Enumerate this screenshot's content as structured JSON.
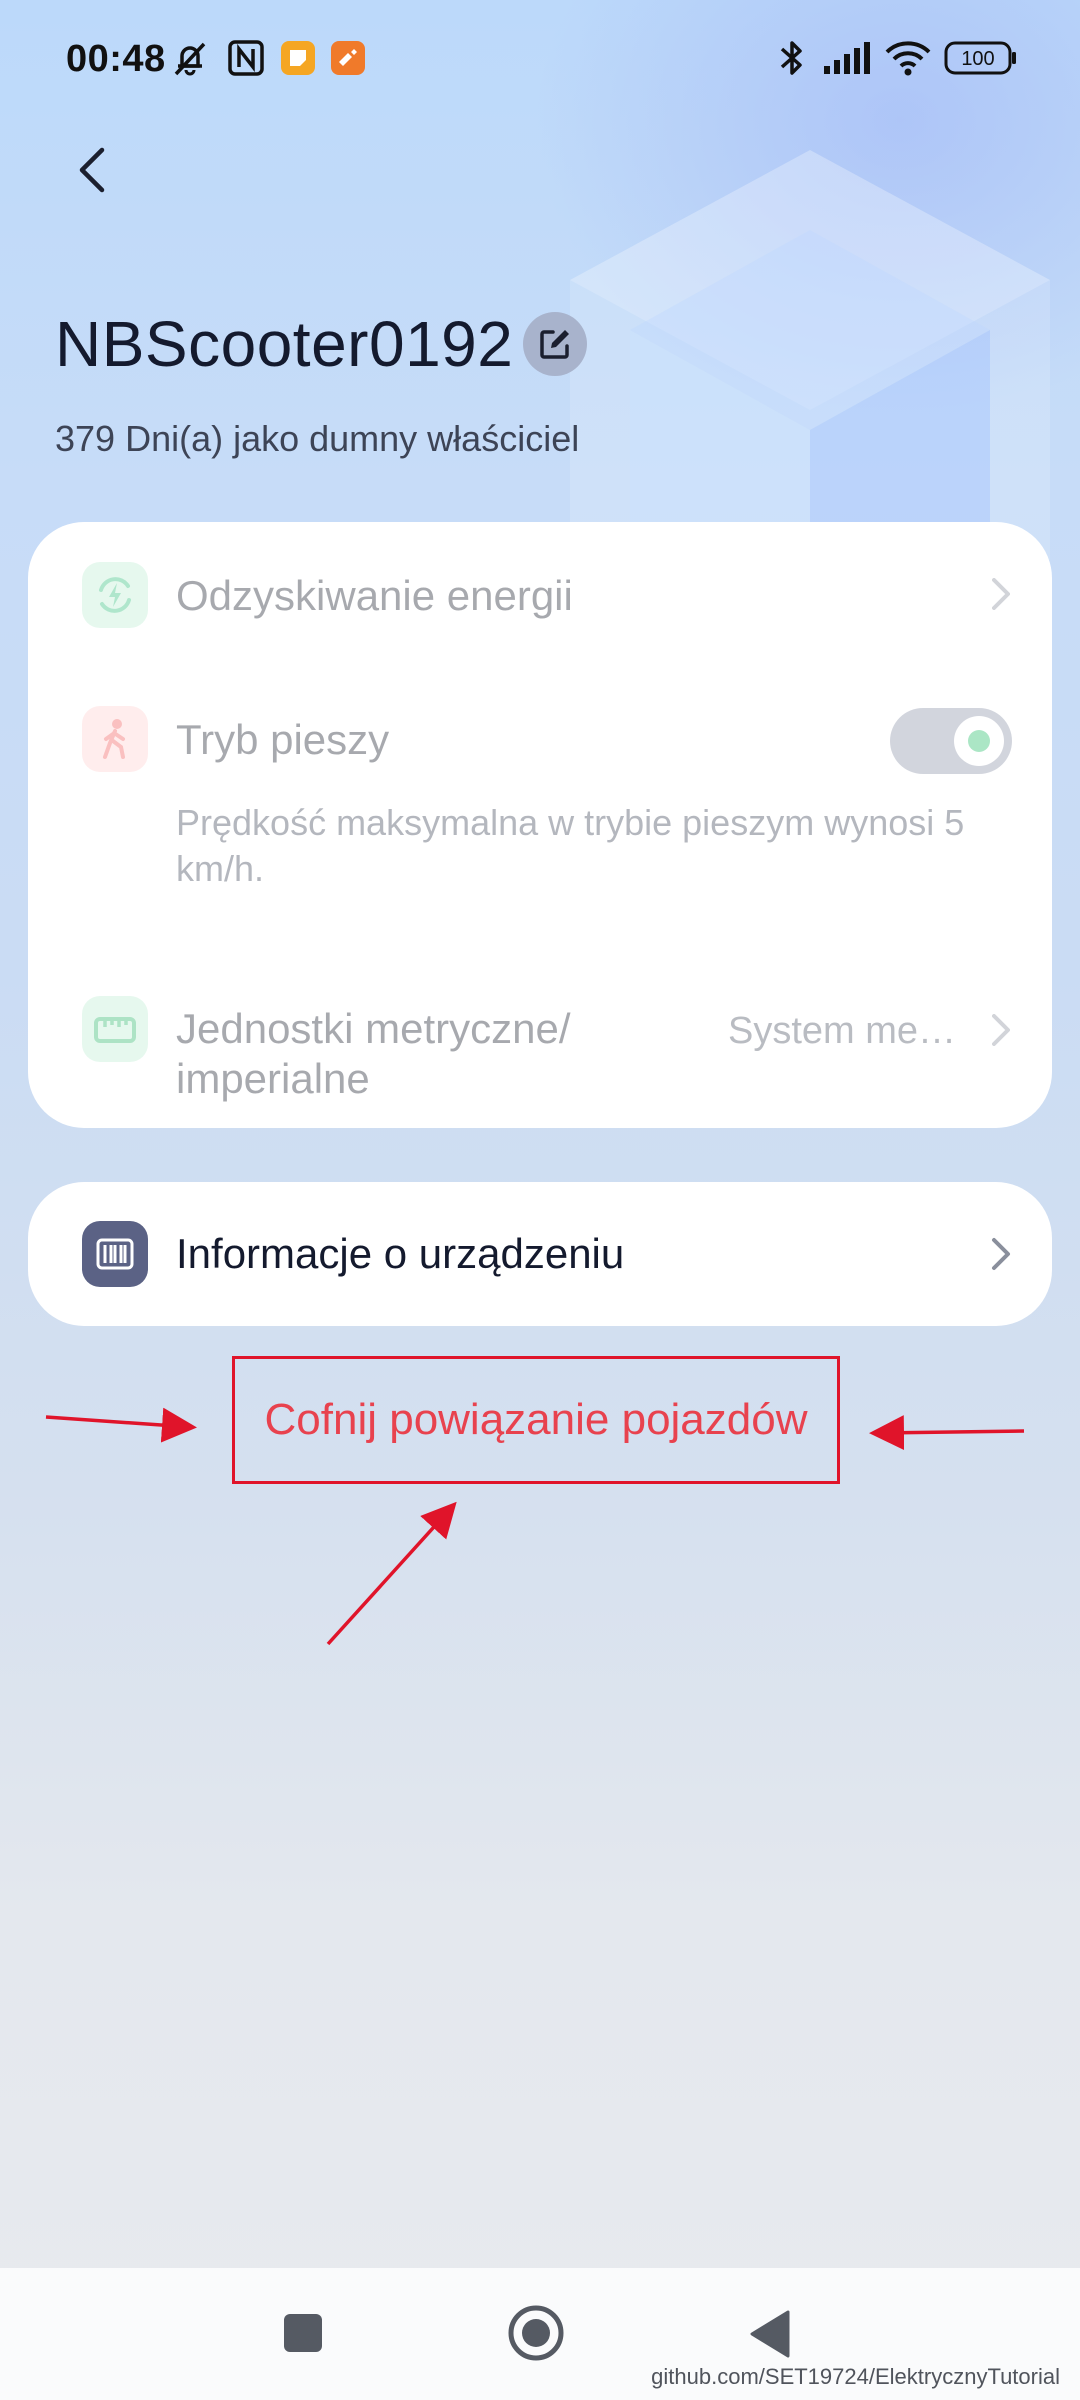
{
  "status_bar": {
    "time": "00:48",
    "left_icons": [
      "notifications-muted-icon",
      "nfc-icon",
      "app-notification-icon",
      "app-notification-icon-2"
    ],
    "right_icons": [
      "bluetooth-icon",
      "cellular-signal-icon",
      "wifi-icon",
      "battery-icon"
    ],
    "battery": "100"
  },
  "header": {
    "device_name": "NBScooter0192",
    "ownership_text": "379 Dni(a) jako dumny właściciel"
  },
  "settings": {
    "energy_recovery": {
      "label": "Odzyskiwanie energii"
    },
    "walk_mode": {
      "label": "Tryb pieszy",
      "description": "Prędkość maksymalna w trybie pieszym wynosi 5 km/h.",
      "enabled": true
    },
    "units": {
      "label": "Jednostki metryczne/ imperialne",
      "value": "System me…"
    }
  },
  "device_info": {
    "label": "Informacje o urządzeniu"
  },
  "unbind": {
    "label": "Cofnij powiązanie pojazdów"
  },
  "watermark": "github.com/SET19724/ElektrycznyTutorial",
  "colors": {
    "annotation_red": "#e0142a",
    "unbind_text": "#e8424e",
    "energy_icon": "#2fc07a",
    "walk_icon": "#f25b5b",
    "units_icon": "#29b86a",
    "device_info_icon": "#5b6285"
  }
}
